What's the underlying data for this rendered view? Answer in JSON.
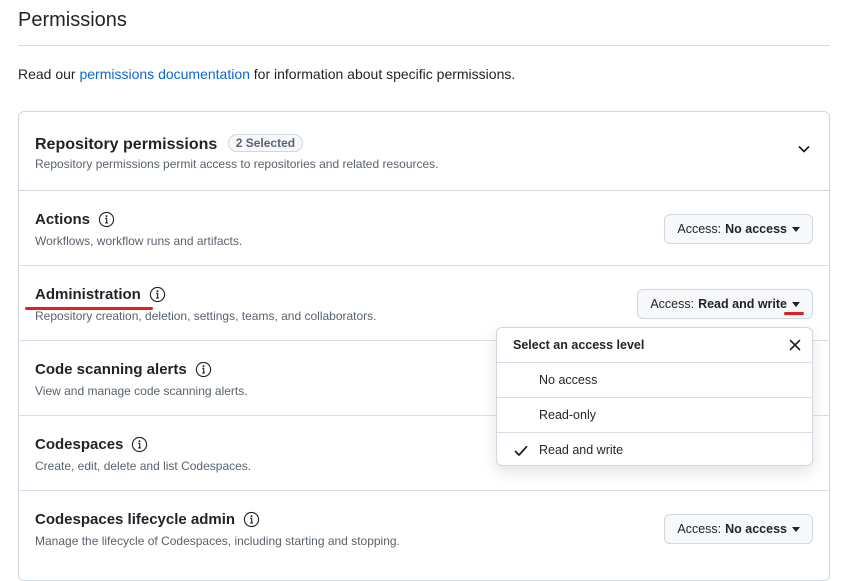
{
  "page": {
    "title": "Permissions",
    "intro_prefix": "Read our ",
    "intro_link": "permissions documentation",
    "intro_suffix": " for information about specific permissions."
  },
  "repository_permissions": {
    "title": "Repository permissions",
    "selected_badge": "2 Selected",
    "description": "Repository permissions permit access to repositories and related resources."
  },
  "permissions": [
    {
      "name": "Actions",
      "description": "Workflows, workflow runs and artifacts.",
      "access_label": "Access:",
      "access_value": "No access"
    },
    {
      "name": "Administration",
      "description": "Repository creation, deletion, settings, teams, and collaborators.",
      "access_label": "Access:",
      "access_value": "Read and write"
    },
    {
      "name": "Code scanning alerts",
      "description": "View and manage code scanning alerts."
    },
    {
      "name": "Codespaces",
      "description": "Create, edit, delete and list Codespaces."
    },
    {
      "name": "Codespaces lifecycle admin",
      "description": "Manage the lifecycle of Codespaces, including starting and stopping.",
      "access_label": "Access:",
      "access_value": "No access"
    }
  ],
  "access_menu": {
    "title": "Select an access level",
    "options": [
      "No access",
      "Read-only",
      "Read and write"
    ],
    "selected": "Read and write"
  },
  "colors": {
    "link": "#0969da",
    "annotation_red": "#e0201e",
    "border": "#d0d7de"
  }
}
